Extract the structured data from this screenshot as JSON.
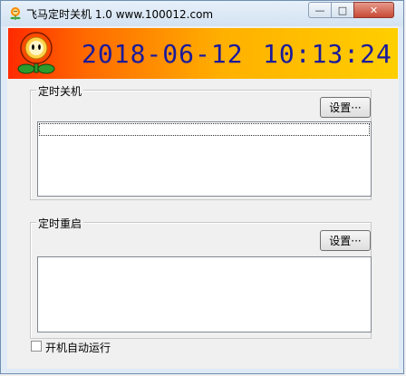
{
  "window": {
    "title": "飞马定时关机 1.0  www.100012.com",
    "minimize": "—",
    "maximize": "□",
    "close": "✕"
  },
  "banner": {
    "date": "2018-06-12",
    "time": "10:13:24",
    "logo": "flower-icon"
  },
  "shutdown_group": {
    "label": "定时关机",
    "button": "设置···"
  },
  "restart_group": {
    "label": "定时重启",
    "button": "设置···"
  },
  "autostart": {
    "label": "开机自动运行",
    "checked": false
  },
  "colors": {
    "banner_start": "#ff2a00",
    "banner_end": "#ffcf00",
    "clock_text": "#1a1a9c"
  }
}
